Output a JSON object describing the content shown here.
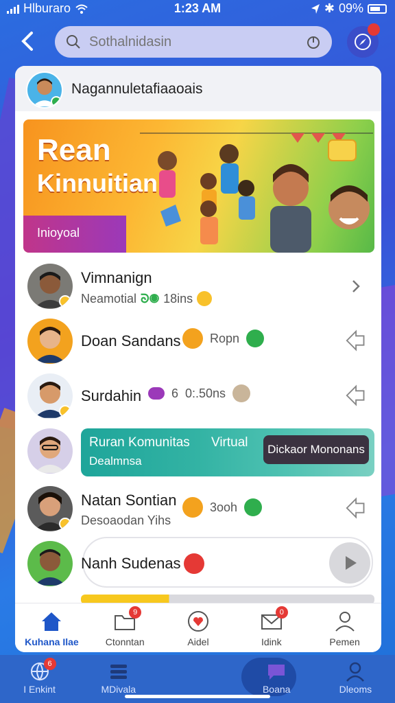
{
  "status_bar": {
    "carrier": "Hlburaro",
    "time": "1:23 AM",
    "battery_text": "09%"
  },
  "search": {
    "placeholder": "Sothalnidasin"
  },
  "profile_header": {
    "name": "Nagannuletafiaaoais"
  },
  "banner": {
    "title_line1": "Rean",
    "title_line2": "Kinnuitian",
    "tag": "Inioyoal"
  },
  "contacts": [
    {
      "name": "Vimnanign",
      "subtitle": "Neamotial",
      "meta_value": "18ins"
    },
    {
      "name": "Doan Sandans",
      "meta_text": "Ropn"
    },
    {
      "name": "Surdahin",
      "meta_number": "6",
      "meta_value": "0:.50ns"
    },
    {
      "name": "Natan Sontian",
      "subtitle": "Desoaodan Yihs",
      "meta_value": "3ooh"
    },
    {
      "name": "Nanh Sudenas"
    }
  ],
  "featured": {
    "title": "Ruran Komunitas",
    "title_suffix": "Virtual",
    "subtitle": "Dealmnsa",
    "button_label": "Dickaor Mononans"
  },
  "tab_bar": [
    {
      "label": "Kuhana Ilae",
      "icon": "home-icon",
      "active": true
    },
    {
      "label": "Ctonntan",
      "icon": "folder-icon",
      "badge": "9"
    },
    {
      "label": "Aidel",
      "icon": "heart-icon"
    },
    {
      "label": "Idink",
      "icon": "mail-icon",
      "badge": "0"
    },
    {
      "label": "Pemen",
      "icon": "person-icon"
    }
  ],
  "bottom_nav": [
    {
      "label": "I Enkint",
      "icon": "globe-icon",
      "badge": "6"
    },
    {
      "label": "MDivala",
      "icon": "list-icon"
    },
    {
      "label": "",
      "icon": "blank"
    },
    {
      "label": "Boana",
      "icon": "chat-icon",
      "active": true
    },
    {
      "label": "Dleoms",
      "icon": "person-icon"
    }
  ],
  "colors": {
    "accent": "#1e56c8",
    "badge": "#e53935",
    "featured": "#1ea59a"
  }
}
